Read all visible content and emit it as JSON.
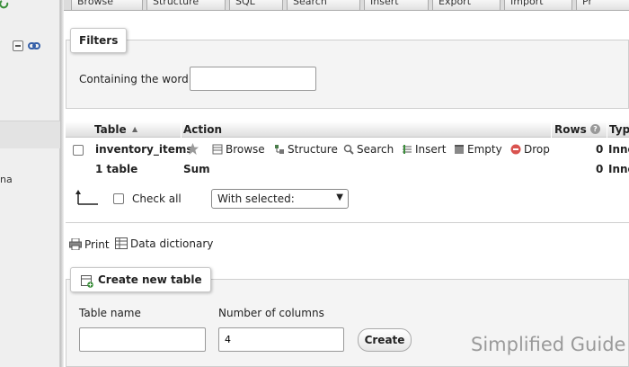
{
  "tabs": [
    {
      "label": "Browse"
    },
    {
      "label": "Structure"
    },
    {
      "label": "SQL"
    },
    {
      "label": "Search"
    },
    {
      "label": "Insert"
    },
    {
      "label": "Export"
    },
    {
      "label": "Import"
    },
    {
      "label": "Pr"
    }
  ],
  "nav": {
    "partial_text": "na"
  },
  "filters": {
    "legend": "Filters",
    "containing_label": "Containing the word:",
    "containing_value": ""
  },
  "table": {
    "headers": {
      "table": "Table",
      "action": "Action",
      "rows": "Rows",
      "type": "Type"
    },
    "row": {
      "name": "inventory_items",
      "actions": {
        "browse": "Browse",
        "structure": "Structure",
        "search": "Search",
        "insert": "Insert",
        "empty": "Empty",
        "drop": "Drop"
      },
      "rows": "0",
      "type": "Inno"
    },
    "summary": {
      "label": "1 table",
      "sum": "Sum",
      "rows": "0",
      "type": "Inno"
    },
    "check_all": "Check all",
    "with_selected": "With selected:"
  },
  "links": {
    "print": "Print",
    "data_dictionary": "Data dictionary"
  },
  "create_table": {
    "legend": "Create new table",
    "table_name_label": "Table name",
    "table_name_value": "",
    "columns_label": "Number of columns",
    "columns_value": "4",
    "create_button": "Create"
  },
  "watermark": "Simplified Guide",
  "colors": {
    "drop_icon": "#d9534f",
    "link_icon": "#355fa8",
    "reload_icon": "#3b8f3b"
  }
}
